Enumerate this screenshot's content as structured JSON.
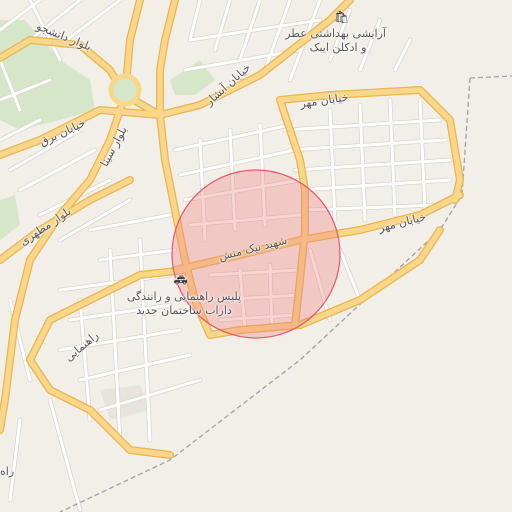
{
  "map": {
    "colors": {
      "background": "#f2efe9",
      "major_road": "#f8d68a",
      "major_road_casing": "#e9b54f",
      "minor_road": "#ffffff",
      "minor_road_casing": "#d8d4cc",
      "park": "#d6e6c8",
      "boundary": "#a0a0a8",
      "highlight_fill": "#f08080",
      "highlight_stroke": "#e05a6a"
    },
    "street_labels": {
      "daneshjoo": "بلوار دانشجو",
      "barq": "خیابان برق",
      "sina": "بلوار سینا",
      "motahari": "بلوار مطهری",
      "abshar": "خیابان آبشار",
      "mehr_top": "خیابان مهر",
      "mehr_right": "خیابان مهر",
      "nik_manesh": "شهید نیک منش",
      "rahnamaei": "راهنمایی"
    },
    "pois": {
      "shop_icon": "shop-icon",
      "shop_line1": "آرایشی بهداشتی عطر",
      "shop_line2": "و ادکلن ایبک",
      "police_icon": "police-icon",
      "police_line1": "پلیس راهنمایی و رانندگی",
      "police_line2": "داراب ساختمان جدید"
    },
    "edge_letter": "راه"
  }
}
